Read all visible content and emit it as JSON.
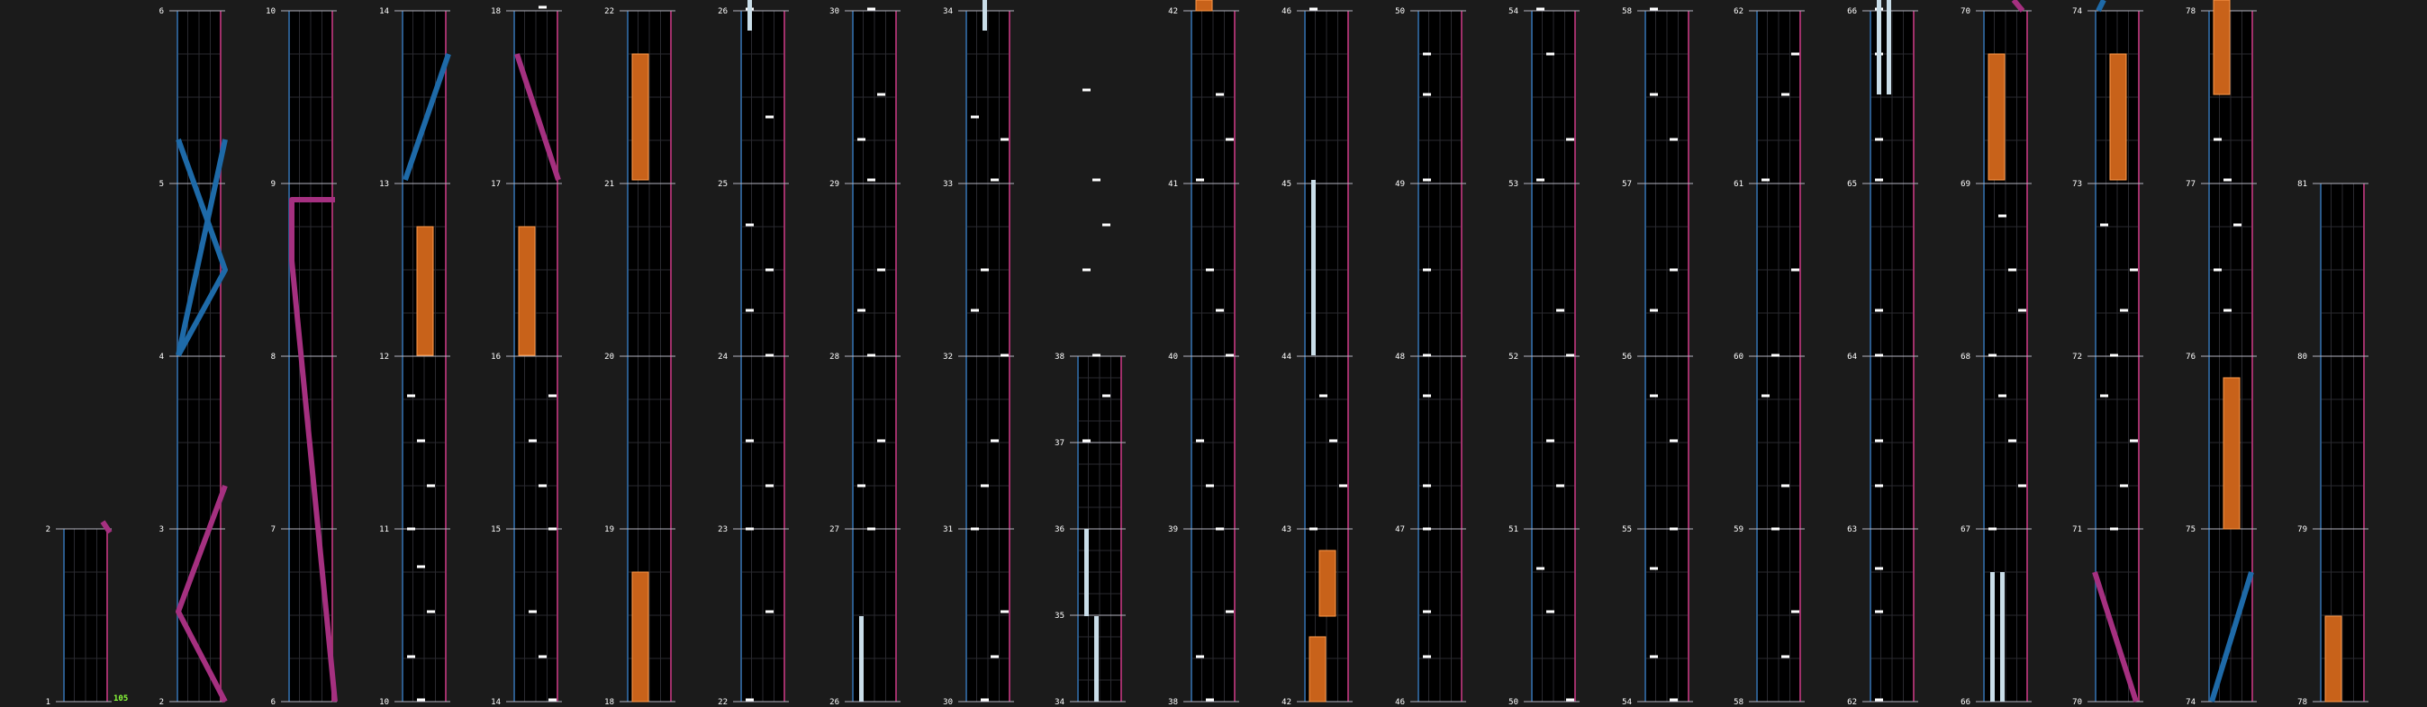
{
  "bpm_label": "105",
  "colors": {
    "background": "#1b1b1b",
    "lane": "#000000",
    "measure_line": "#b5b5c0",
    "grid_line": "#2a2a30",
    "left_border": "#2b5a8a",
    "right_border": "#a0306a",
    "tap_note": "#ffffff",
    "long_note": "#c9dde8",
    "hold_body": "#c8621a",
    "hold_edge": "#ff9a4a",
    "slide_blue": "#1e6aa8",
    "slide_pink": "#a53080"
  },
  "columns": [
    {
      "measures": [
        1,
        2
      ],
      "events": []
    },
    {
      "measures": [
        2,
        3,
        4,
        5,
        6
      ],
      "events": []
    },
    {
      "measures": [
        6,
        7,
        8,
        9,
        10
      ],
      "events": []
    },
    {
      "measures": [
        10,
        11,
        12,
        13,
        14
      ],
      "events": []
    },
    {
      "measures": [
        14,
        15,
        16,
        17,
        18
      ],
      "events": []
    },
    {
      "measures": [
        18,
        19,
        20,
        21,
        22
      ],
      "events": []
    },
    {
      "measures": [
        22,
        23,
        24,
        25,
        26
      ],
      "events": []
    },
    {
      "measures": [
        26,
        27,
        28,
        29,
        30
      ],
      "events": []
    },
    {
      "measures": [
        30,
        31,
        32,
        33,
        34
      ],
      "events": []
    },
    {
      "measures": [
        34,
        35,
        36,
        37,
        38
      ],
      "events": []
    },
    {
      "measures": [
        38,
        39,
        40,
        41,
        42
      ],
      "events": []
    },
    {
      "measures": [
        42,
        43,
        44,
        45,
        46
      ],
      "events": []
    },
    {
      "measures": [
        46,
        47,
        48,
        49,
        50
      ],
      "events": []
    },
    {
      "measures": [
        50,
        51,
        52,
        53,
        54
      ],
      "events": []
    },
    {
      "measures": [
        54,
        55,
        56,
        57,
        58
      ],
      "events": []
    },
    {
      "measures": [
        58,
        59,
        60,
        61,
        62
      ],
      "events": []
    },
    {
      "measures": [
        62,
        63,
        64,
        65,
        66
      ],
      "events": []
    },
    {
      "measures": [
        66,
        67,
        68,
        69,
        70
      ],
      "events": []
    },
    {
      "measures": [
        70,
        71,
        72,
        73,
        74
      ],
      "events": []
    },
    {
      "measures": [
        74,
        75,
        76,
        77,
        78
      ],
      "events": []
    },
    {
      "measures": [
        78,
        79,
        80,
        81
      ],
      "events": []
    }
  ]
}
